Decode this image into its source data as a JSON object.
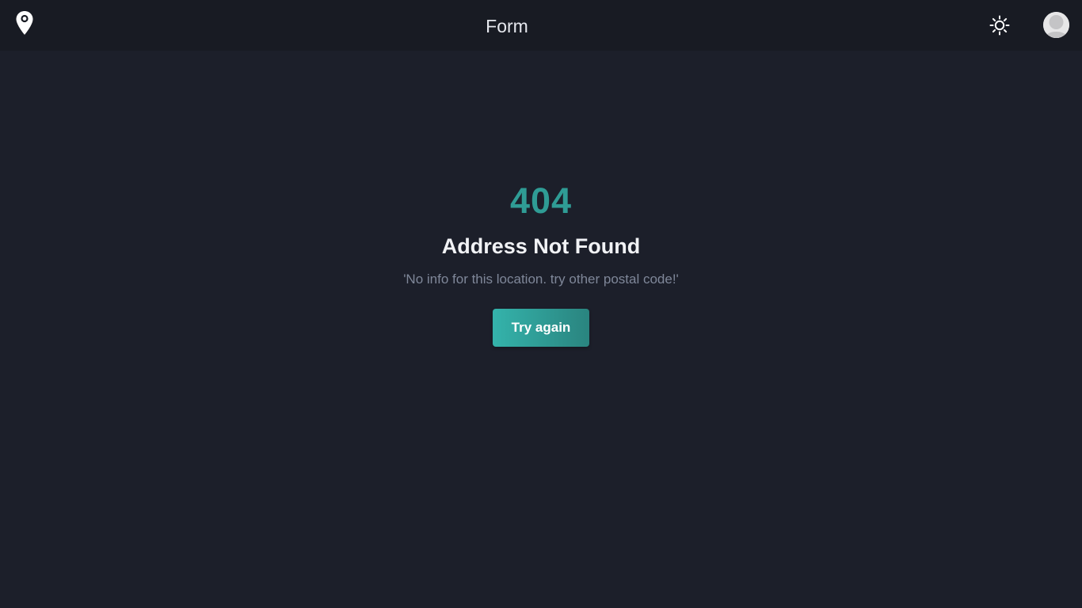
{
  "header": {
    "title": "Form",
    "logo_icon": "map-pin-icon",
    "theme_icon": "sun-icon",
    "avatar_icon": "user-avatar-icon"
  },
  "error": {
    "code": "404",
    "title": "Address Not Found",
    "message": "'No info for this location. try other postal code!'",
    "button_label": "Try again"
  },
  "colors": {
    "background": "#1c1f2a",
    "header_background": "#181b23",
    "accent": "#2f9c95",
    "button_gradient_start": "#34b3ab",
    "button_gradient_end": "#2a847f",
    "message_text": "#7f8799"
  }
}
